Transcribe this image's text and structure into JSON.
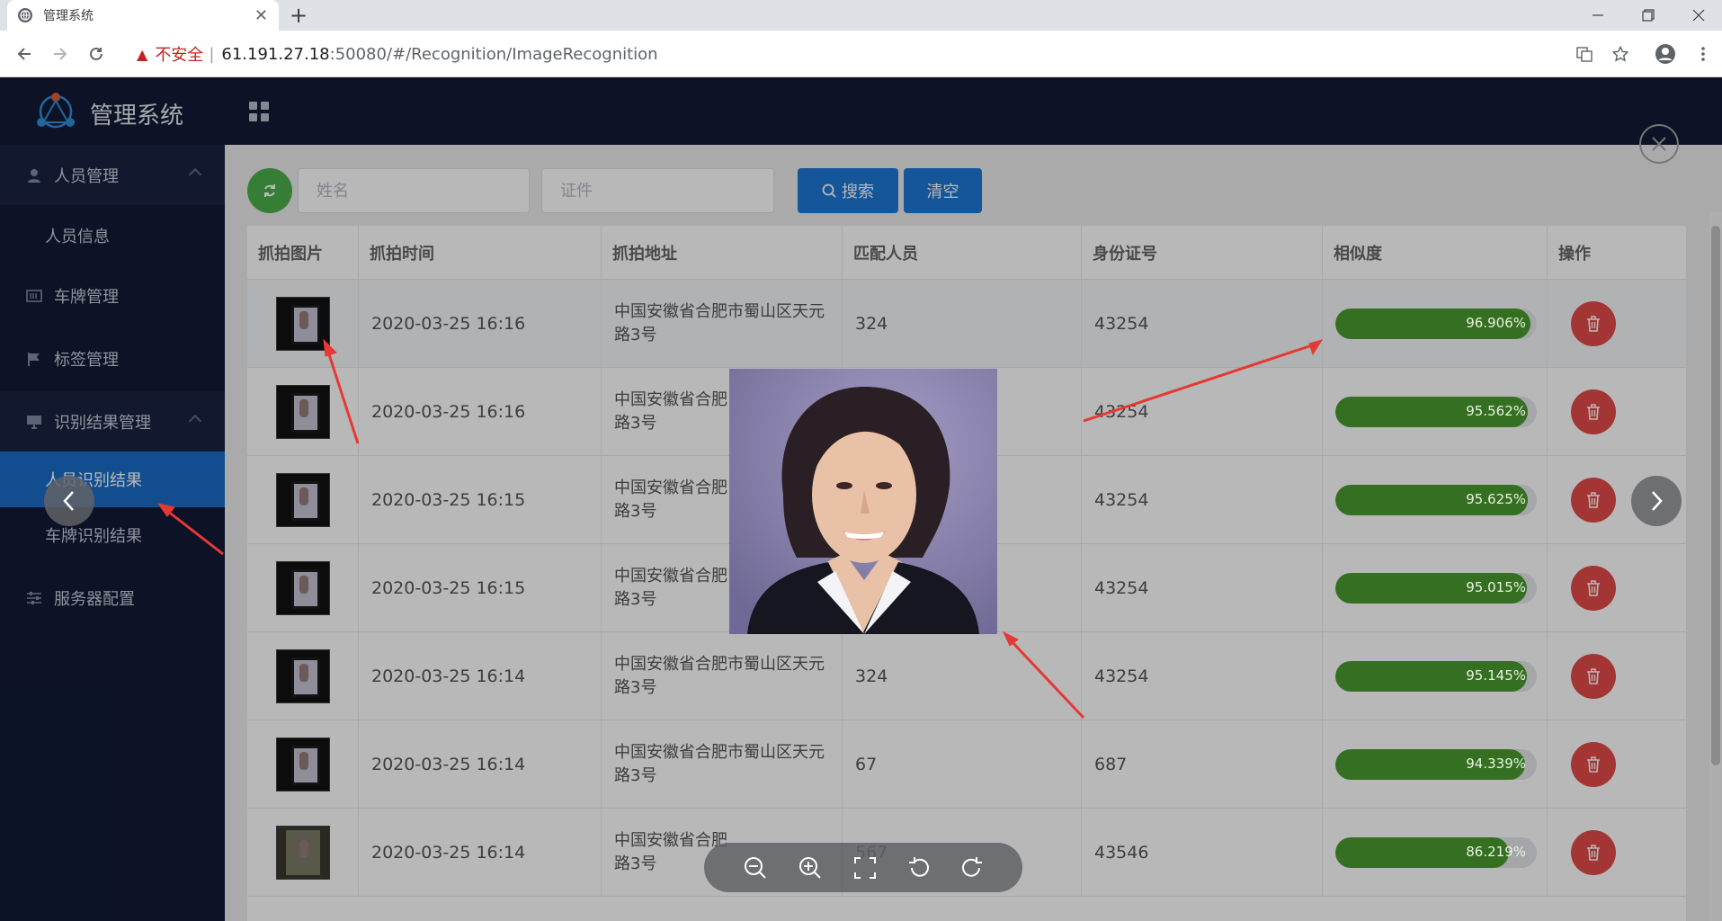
{
  "browser": {
    "tab_title": "管理系统",
    "tab_close": "✕",
    "new_tab": "+",
    "insecure_label": "不安全",
    "separator": "|",
    "url_host": "61.191.27.18",
    "url_path": ":50080/#/Recognition/ImageRecognition"
  },
  "app": {
    "brand": "管理系统"
  },
  "sidebar": {
    "items": [
      {
        "label": "人员管理"
      },
      {
        "label": "人员信息"
      },
      {
        "label": "车牌管理"
      },
      {
        "label": "标签管理"
      },
      {
        "label": "识别结果管理"
      },
      {
        "label": "人员识别结果"
      },
      {
        "label": "车牌识别结果"
      },
      {
        "label": "服务器配置"
      }
    ]
  },
  "filters": {
    "name_placeholder": "姓名",
    "id_placeholder": "证件",
    "search_label": "搜索",
    "clear_label": "清空"
  },
  "table": {
    "headers": [
      "抓拍图片",
      "抓拍时间",
      "抓拍地址",
      "匹配人员",
      "身份证号",
      "相似度",
      "操作"
    ],
    "rows": [
      {
        "time": "2020-03-25 16:16",
        "addr1": "中国安徽省合肥市蜀山区天元",
        "addr2": "路3号",
        "person": "324",
        "id": "43254",
        "sim": "96.906%",
        "simv": 0.96906
      },
      {
        "time": "2020-03-25 16:16",
        "addr1": "中国安徽省合肥",
        "addr2": "路3号",
        "person": "",
        "id": "43254",
        "sim": "95.562%",
        "simv": 0.95562
      },
      {
        "time": "2020-03-25 16:15",
        "addr1": "中国安徽省合肥",
        "addr2": "路3号",
        "person": "",
        "id": "43254",
        "sim": "95.625%",
        "simv": 0.95625
      },
      {
        "time": "2020-03-25 16:15",
        "addr1": "中国安徽省合肥",
        "addr2": "路3号",
        "person": "",
        "id": "43254",
        "sim": "95.015%",
        "simv": 0.95015
      },
      {
        "time": "2020-03-25 16:14",
        "addr1": "中国安徽省合肥市蜀山区天元",
        "addr2": "路3号",
        "person": "324",
        "id": "43254",
        "sim": "95.145%",
        "simv": 0.95145
      },
      {
        "time": "2020-03-25 16:14",
        "addr1": "中国安徽省合肥市蜀山区天元",
        "addr2": "路3号",
        "person": "67",
        "id": "687",
        "sim": "94.339%",
        "simv": 0.94339
      },
      {
        "time": "2020-03-25 16:14",
        "addr1": "中国安徽省合肥",
        "addr2": "路3号",
        "person": "567",
        "id": "43546",
        "sim": "86.219%",
        "simv": 0.86219
      }
    ]
  },
  "colors": {
    "sidebar_bg": "#121a36",
    "active": "#1a6dc7",
    "progress": "#4a9a2f",
    "delete": "#e44a4a"
  }
}
